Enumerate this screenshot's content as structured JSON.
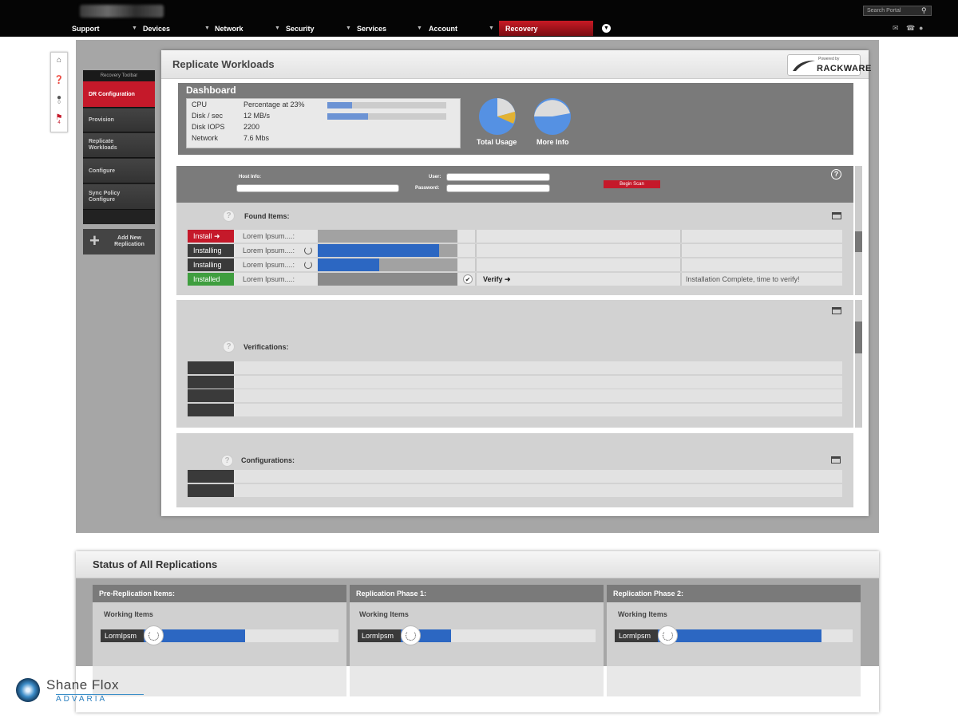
{
  "topnav": {
    "search_placeholder": "Search Portal",
    "items": [
      {
        "label": "Support"
      },
      {
        "label": "Devices"
      },
      {
        "label": "Network"
      },
      {
        "label": "Security"
      },
      {
        "label": "Services"
      },
      {
        "label": "Account"
      }
    ],
    "active_item": "Recovery",
    "icons": [
      "search-icon",
      "chat-icon",
      "phone-icon",
      "comment-icon",
      "chevron-down-icon"
    ]
  },
  "side_icons": {
    "alerts_count": "0",
    "tags_count": "4"
  },
  "toolbar": {
    "title": "Recovery Toolbar",
    "items": [
      {
        "label": "DR Configuration",
        "active": true
      },
      {
        "label": "Provision"
      },
      {
        "label": "Replicate Workloads"
      },
      {
        "label": "Configure"
      },
      {
        "label": "Sync Policy Configure"
      }
    ],
    "add_new": "Add New Replication"
  },
  "panel": {
    "title": "Replicate Workloads",
    "logo": {
      "powered_by": "Powered by",
      "name": "RACKWARE"
    }
  },
  "dashboard": {
    "title": "Dashboard",
    "stats": [
      {
        "label": "CPU",
        "value": "Percentage at 23%",
        "bar_fraction": 0.21
      },
      {
        "label": "Disk / sec",
        "value": "12 MB/s",
        "bar_fraction": 0.34
      },
      {
        "label": "Disk IOPS",
        "value": "2200"
      },
      {
        "label": "Network",
        "value": "7.6 Mbs"
      }
    ],
    "pies": [
      {
        "label": "Total Usage"
      },
      {
        "label": "More Info"
      }
    ]
  },
  "scan": {
    "host_label": "Host Info:",
    "user_label": "User:",
    "password_label": "Password:",
    "begin_button": "Begin Scan",
    "found_title": "Found Items:",
    "rows": [
      {
        "status": "Install ➜",
        "status_color": "#c5192a",
        "name": "Lorem Ipsum....:",
        "progress": 0,
        "col2": "",
        "col3": ""
      },
      {
        "status": "Installing",
        "status_color": "#3a3a3a",
        "name": "Lorem Ipsum....:",
        "progress": 0.87,
        "col2": "",
        "col3": ""
      },
      {
        "status": "Installing",
        "status_color": "#3a3a3a",
        "name": "Lorem Ipsum....:",
        "progress": 0.44,
        "col2": "",
        "col3": ""
      },
      {
        "status": "Installed",
        "status_color": "#3f9e3f",
        "name": "Lorem Ipsum....:",
        "progress": 0,
        "col2": "Verify ➜",
        "col3": "Installation Complete, time to verify!"
      }
    ]
  },
  "verifications": {
    "title": "Verifications:"
  },
  "configurations": {
    "title": "Configurations:"
  },
  "status": {
    "title": "Status of All Replications",
    "columns": [
      {
        "title": "Pre-Replication Items:",
        "working": "Working Items",
        "item": "LormIpsm",
        "progress": 0.52
      },
      {
        "title": "Replication Phase 1:",
        "working": "Working Items",
        "item": "LormIpsm",
        "progress": 0.26
      },
      {
        "title": "Replication Phase 2:",
        "working": "Working Items",
        "item": "LormIpsm",
        "progress": 0.84
      }
    ]
  },
  "footer_logo": {
    "name": "Shane Flox",
    "sub": "ADVARIA"
  }
}
